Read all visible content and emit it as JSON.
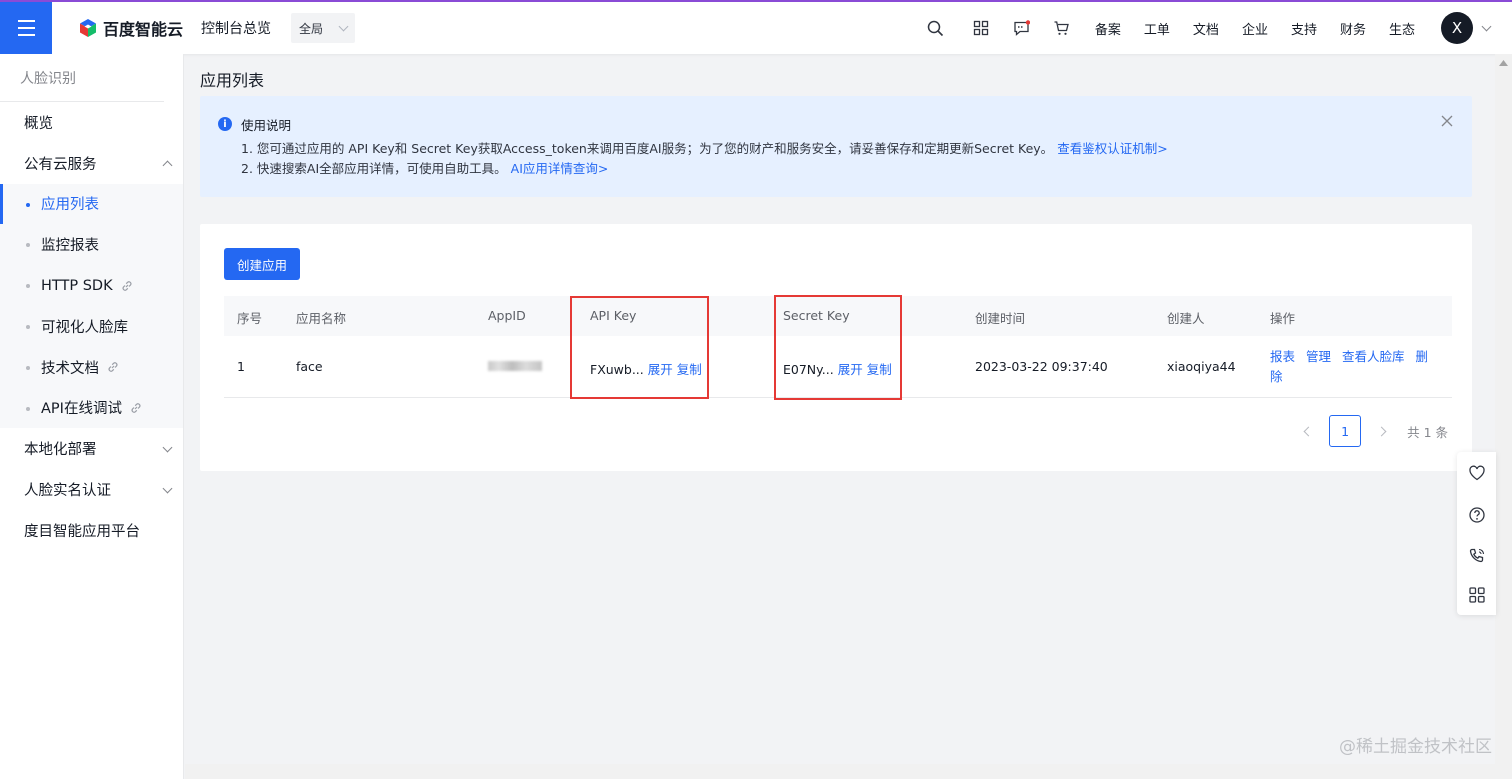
{
  "header": {
    "brand": "百度智能云",
    "console_link": "控制台总览",
    "scope_select": "全局",
    "nav": [
      "备案",
      "工单",
      "文档",
      "企业",
      "支持",
      "财务",
      "生态"
    ],
    "avatar_letter": "X"
  },
  "sidebar": {
    "title": "人脸识别",
    "items": [
      {
        "label": "概览"
      },
      {
        "label": "公有云服务"
      },
      {
        "label": "本地化部署"
      },
      {
        "label": "人脸实名认证"
      },
      {
        "label": "度目智能应用平台"
      }
    ],
    "sub_items": [
      {
        "label": "应用列表",
        "active": true
      },
      {
        "label": "监控报表"
      },
      {
        "label": "HTTP SDK",
        "external": true
      },
      {
        "label": "可视化人脸库"
      },
      {
        "label": "技术文档",
        "external": true
      },
      {
        "label": "API在线调试",
        "external": true
      }
    ]
  },
  "page": {
    "title": "应用列表",
    "notice": {
      "heading": "使用说明",
      "line1": "1. 您可通过应用的 API Key和 Secret Key获取Access_token来调用百度AI服务；为了您的财产和服务安全，请妥善保存和定期更新Secret Key。",
      "line1_link": "查看鉴权认证机制>",
      "line2": "2. 快速搜索AI全部应用详情，可使用自助工具。",
      "line2_link": "AI应用详情查询>"
    },
    "create_button": "创建应用",
    "table": {
      "columns": [
        "序号",
        "应用名称",
        "AppID",
        "API Key",
        "Secret Key",
        "创建时间",
        "创建人",
        "操作"
      ],
      "rows": [
        {
          "index": "1",
          "name": "face",
          "appid": "",
          "api_key": "FXuwb...",
          "secret_key": "E07Ny...",
          "created": "2023-03-22 09:37:40",
          "creator": "xiaoqiya44"
        }
      ],
      "expand_label": "展开",
      "copy_label": "复制",
      "actions": {
        "report": "报表",
        "manage": "管理",
        "view_faces": "查看人脸库",
        "delete_a": "删",
        "delete_b": "除"
      }
    },
    "pagination": {
      "current": "1",
      "total_text": "共 1 条"
    }
  },
  "watermark": "@稀土掘金技术社区",
  "colors": {
    "accent": "#2468f2",
    "highlight_box": "#e53935",
    "notice_bg": "#e6f0ff"
  }
}
